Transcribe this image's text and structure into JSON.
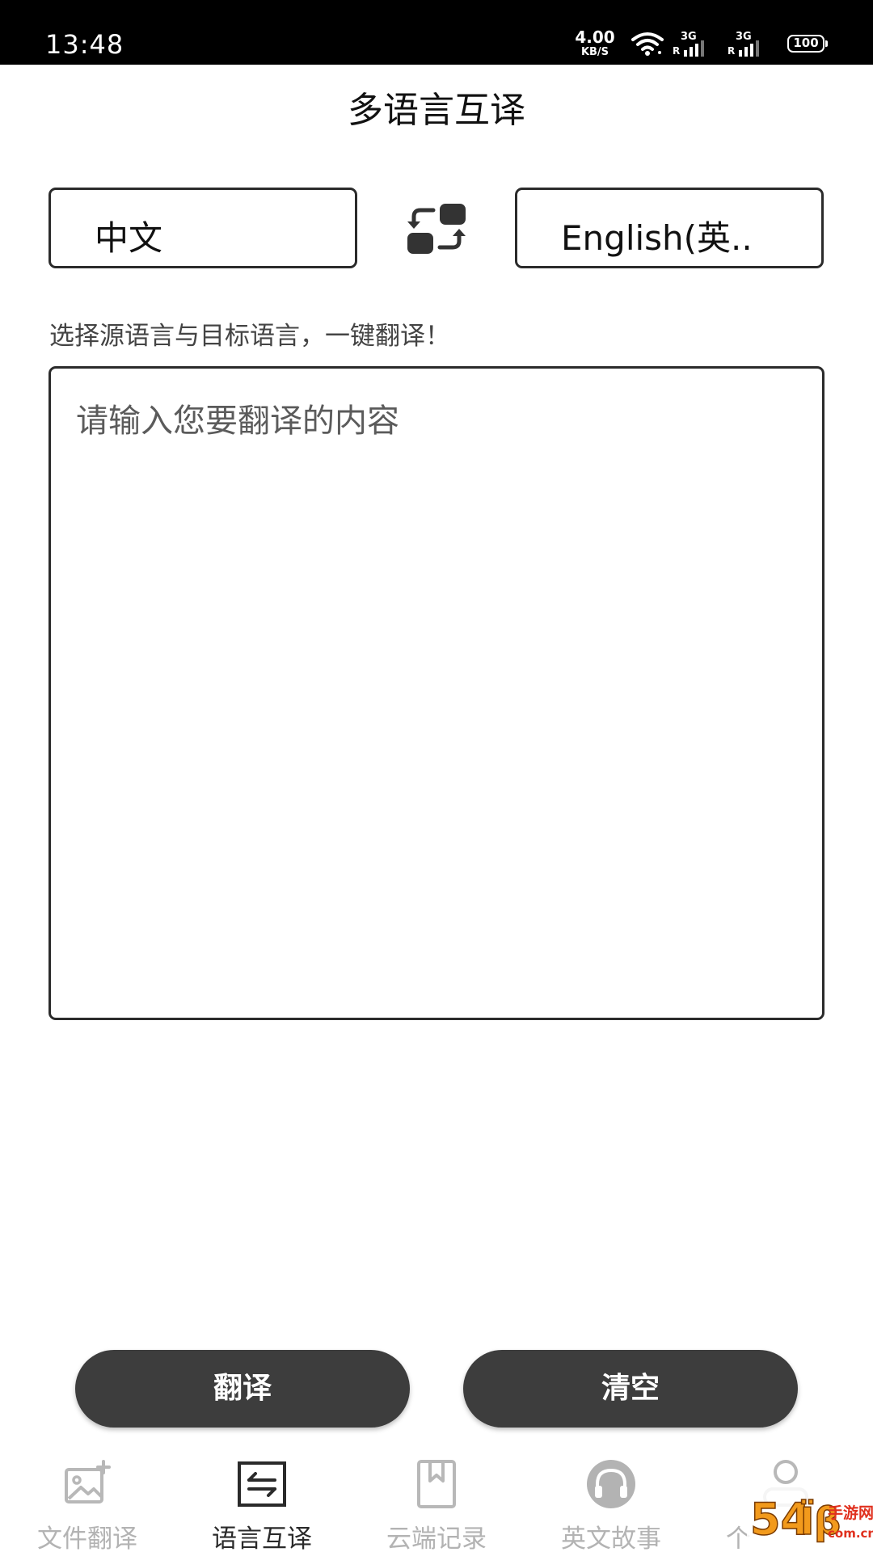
{
  "status_bar": {
    "time": "13:48",
    "net_speed_value": "4.00",
    "net_speed_unit": "KB/S",
    "sim1_type": "3G",
    "sim2_type": "3G",
    "roaming_mark": "R",
    "battery": "100",
    "icons": [
      "wifi-icon",
      "signal-icon",
      "battery-icon"
    ]
  },
  "header": {
    "title": "多语言互译"
  },
  "languages": {
    "source": "中文",
    "target": "English(英..",
    "swap_icon": "swap-languages-icon"
  },
  "hint": "选择源语言与目标语言，一键翻译！",
  "input": {
    "placeholder": "请输入您要翻译的内容",
    "value": ""
  },
  "actions": {
    "translate_label": "翻译",
    "clear_label": "清空"
  },
  "bottom_nav": {
    "active_index": 1,
    "items": [
      {
        "label": "文件翻译",
        "icon": "image-add-icon"
      },
      {
        "label": "语言互译",
        "icon": "swap-arrows-icon"
      },
      {
        "label": "云端记录",
        "icon": "bookmark-icon"
      },
      {
        "label": "英文故事",
        "icon": "headphones-icon"
      },
      {
        "label": "个",
        "icon": "person-icon"
      }
    ]
  },
  "watermark": {
    "text": "54118手游网",
    "subtext": "com.cn"
  },
  "colors": {
    "status_bar_bg": "#000000",
    "button_bg": "#3d3d3d",
    "nav_active": "#2a2a2a",
    "nav_inactive": "#b3b3b3",
    "watermark_orange": "#f29a1c",
    "watermark_red": "#e0301e"
  }
}
